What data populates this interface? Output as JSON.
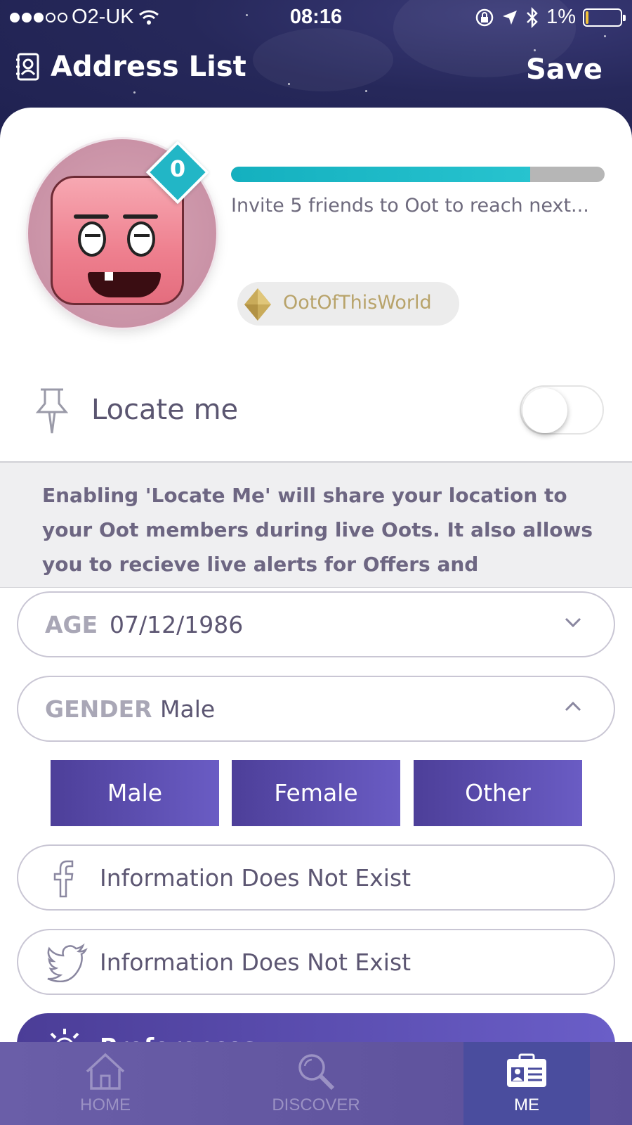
{
  "status_bar": {
    "carrier": "O2-UK",
    "time": "08:16",
    "battery": "1%"
  },
  "header": {
    "title": "Address List",
    "title_icon": "address-book-icon",
    "save_label": "Save"
  },
  "profile": {
    "level": "0",
    "progress_fraction": 0.8,
    "progress_text": "Invite 5 friends to Oot to reach next...",
    "tag": "OotOfThisWorld",
    "colors": {
      "progress": "#1cb8c6",
      "badge": "#22b6c6",
      "tag_text": "#b8a36a"
    }
  },
  "locate": {
    "label": "Locate me",
    "enabled": false,
    "info": "Enabling 'Locate Me' will share your location to your Oot members during live Oots. It also allows you to recieve live alerts for Offers and"
  },
  "fields": {
    "age_key": "AGE",
    "age_value": "07/12/1986",
    "gender_key": "GENDER",
    "gender_value": "Male",
    "gender_options": [
      "Male",
      "Female",
      "Other"
    ],
    "facebook_text": "Information Does Not Exist",
    "twitter_text": "Information Does Not Exist",
    "preferences_label": "Preferences"
  },
  "tabbar": {
    "tabs": [
      {
        "label": "HOME",
        "icon": "home-icon"
      },
      {
        "label": "DISCOVER",
        "icon": "search-icon"
      },
      {
        "label": "ME",
        "icon": "profile-card-icon"
      }
    ],
    "active": "ME"
  },
  "theme": {
    "accent_purple": "#5b4fb0",
    "header_navy": "#23265a"
  }
}
